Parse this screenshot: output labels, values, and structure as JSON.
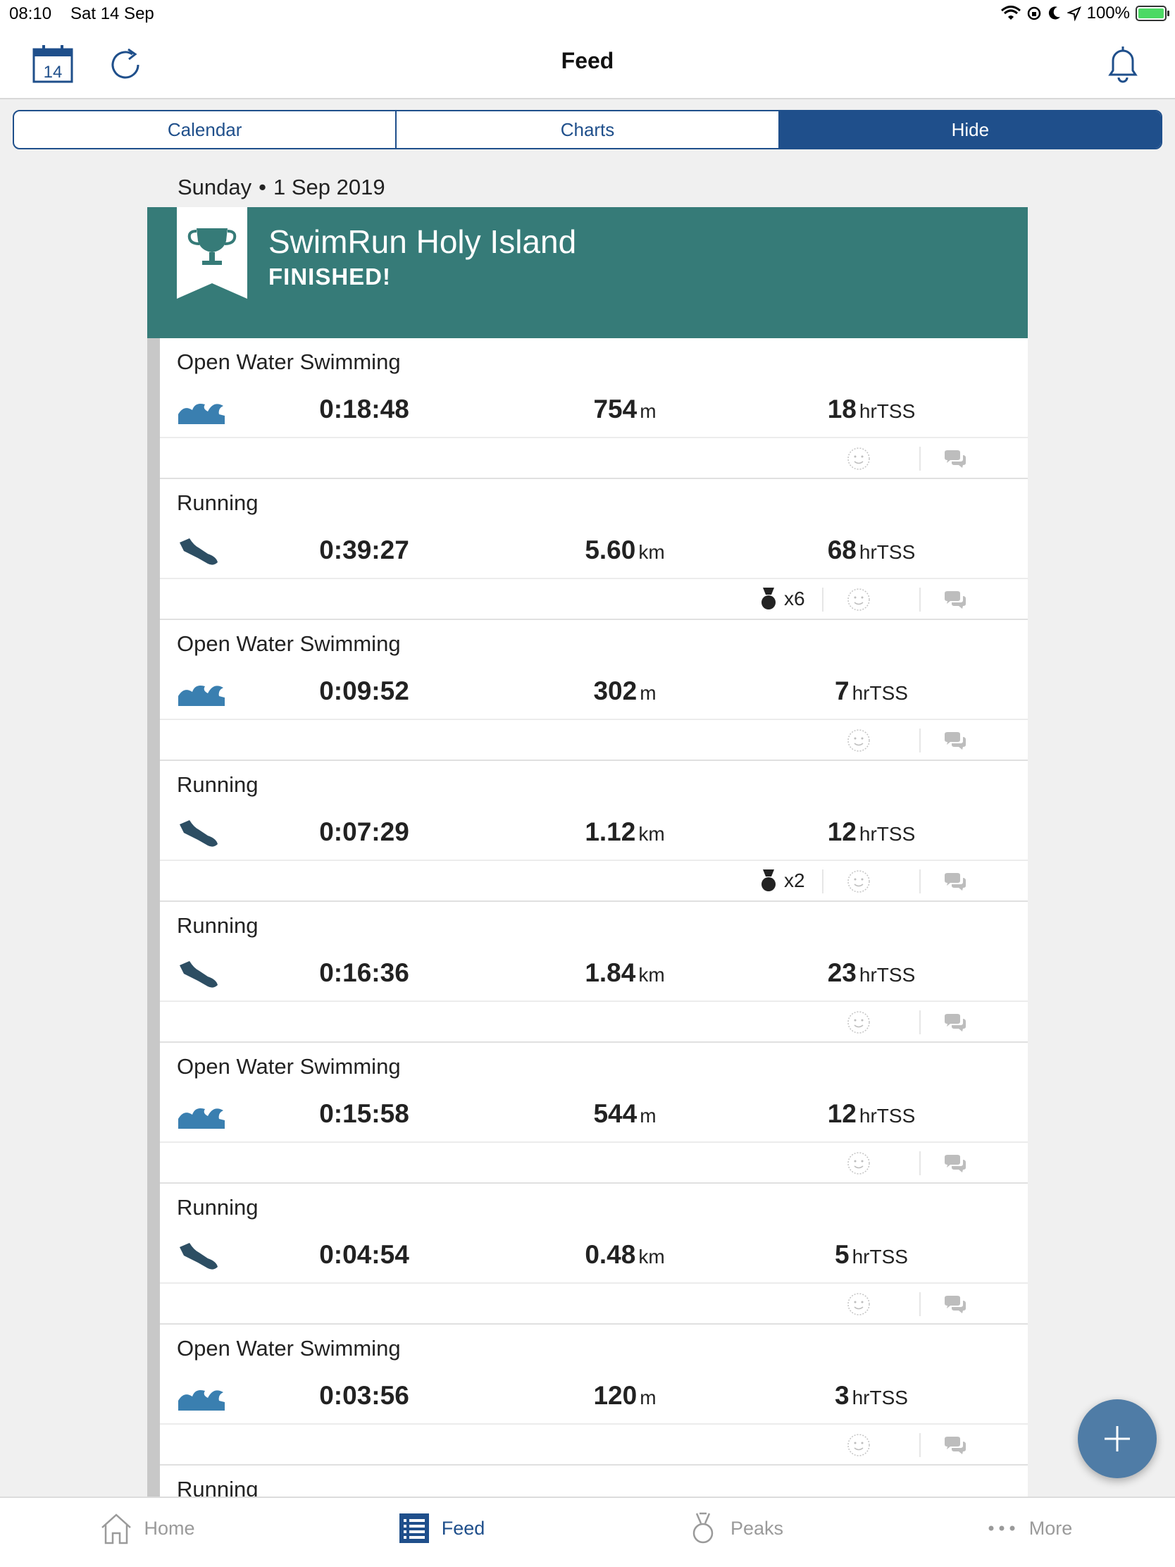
{
  "status_bar": {
    "time": "08:10",
    "date": "Sat 14 Sep",
    "battery": "100%"
  },
  "nav": {
    "title": "Feed",
    "calendar_day": "14"
  },
  "segments": [
    {
      "label": "Calendar",
      "active": false
    },
    {
      "label": "Charts",
      "active": false
    },
    {
      "label": "Hide",
      "active": true
    }
  ],
  "day": {
    "weekday": "Sunday",
    "separator": "•",
    "date": "1 Sep 2019"
  },
  "event": {
    "title": "SwimRun Holy Island",
    "status": "FINISHED!"
  },
  "workouts": [
    {
      "type": "Open Water Swimming",
      "sport": "swim",
      "duration": "0:18:48",
      "distance": "754",
      "distance_unit": "m",
      "tss": "18",
      "tss_unit": "hrTSS",
      "medals": ""
    },
    {
      "type": "Running",
      "sport": "run",
      "duration": "0:39:27",
      "distance": "5.60",
      "distance_unit": "km",
      "tss": "68",
      "tss_unit": "hrTSS",
      "medals": "x6"
    },
    {
      "type": "Open Water Swimming",
      "sport": "swim",
      "duration": "0:09:52",
      "distance": "302",
      "distance_unit": "m",
      "tss": "7",
      "tss_unit": "hrTSS",
      "medals": ""
    },
    {
      "type": "Running",
      "sport": "run",
      "duration": "0:07:29",
      "distance": "1.12",
      "distance_unit": "km",
      "tss": "12",
      "tss_unit": "hrTSS",
      "medals": "x2"
    },
    {
      "type": "Running",
      "sport": "run",
      "duration": "0:16:36",
      "distance": "1.84",
      "distance_unit": "km",
      "tss": "23",
      "tss_unit": "hrTSS",
      "medals": ""
    },
    {
      "type": "Open Water Swimming",
      "sport": "swim",
      "duration": "0:15:58",
      "distance": "544",
      "distance_unit": "m",
      "tss": "12",
      "tss_unit": "hrTSS",
      "medals": ""
    },
    {
      "type": "Running",
      "sport": "run",
      "duration": "0:04:54",
      "distance": "0.48",
      "distance_unit": "km",
      "tss": "5",
      "tss_unit": "hrTSS",
      "medals": ""
    },
    {
      "type": "Open Water Swimming",
      "sport": "swim",
      "duration": "0:03:56",
      "distance": "120",
      "distance_unit": "m",
      "tss": "3",
      "tss_unit": "hrTSS",
      "medals": ""
    },
    {
      "type": "Running",
      "sport": "run",
      "partial": true
    }
  ],
  "tabs": [
    {
      "label": "Home",
      "icon": "home-icon",
      "active": false
    },
    {
      "label": "Feed",
      "icon": "feed-list-icon",
      "active": true
    },
    {
      "label": "Peaks",
      "icon": "medal-icon",
      "active": false
    },
    {
      "label": "More",
      "icon": "more-dots-icon",
      "active": false
    }
  ],
  "colors": {
    "brand_blue": "#1f4f8b",
    "event_teal": "#367b78",
    "swim_blue": "#3a7fb0",
    "run_dark": "#2d4e63",
    "fab": "#4f7ca6"
  }
}
